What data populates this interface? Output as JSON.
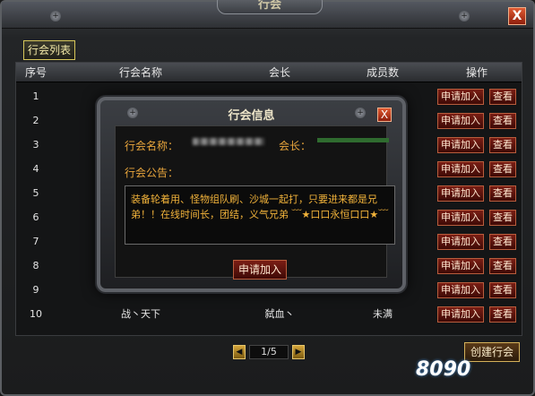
{
  "window": {
    "title": "行会",
    "close_label": "X"
  },
  "tab": {
    "label": "行会列表"
  },
  "table": {
    "headers": [
      "序号",
      "行会名称",
      "会长",
      "成员数",
      "操作"
    ],
    "apply_label": "申请加入",
    "view_label": "查看",
    "rows": [
      {
        "idx": "1",
        "name": "",
        "leader": "",
        "members": ""
      },
      {
        "idx": "2",
        "name": "",
        "leader": "",
        "members": ""
      },
      {
        "idx": "3",
        "name": "",
        "leader": "",
        "members": ""
      },
      {
        "idx": "4",
        "name": "",
        "leader": "",
        "members": ""
      },
      {
        "idx": "5",
        "name": "",
        "leader": "",
        "members": ""
      },
      {
        "idx": "6",
        "name": "",
        "leader": "",
        "members": ""
      },
      {
        "idx": "7",
        "name": "",
        "leader": "",
        "members": ""
      },
      {
        "idx": "8",
        "name": "",
        "leader": "",
        "members": ""
      },
      {
        "idx": "9",
        "name": "",
        "leader": "",
        "members": ""
      },
      {
        "idx": "10",
        "name": "战丶天下",
        "leader": "弑血丶",
        "members": "未满"
      }
    ]
  },
  "pager": {
    "text": "1/5",
    "prev_symbol": "◀",
    "next_symbol": "▶"
  },
  "create_button": {
    "label": "创建行会"
  },
  "watermark": {
    "text": "8090"
  },
  "popup": {
    "title": "行会信息",
    "close_label": "X",
    "name_label": "行会名称：",
    "leader_label": "会长：",
    "notice_label": "行会公告：",
    "notice_text": "装备轮着用、怪物组队刷、沙城一起打，只要进来都是兄弟！！在线时间长，团结，义气兄弟 ﹋★口口永恒口口★﹋",
    "apply_label": "申请加入"
  },
  "colors": {
    "accent_gold": "#e8a53c",
    "button_red": "#7a1e14",
    "tab_border": "#d6c65a"
  }
}
